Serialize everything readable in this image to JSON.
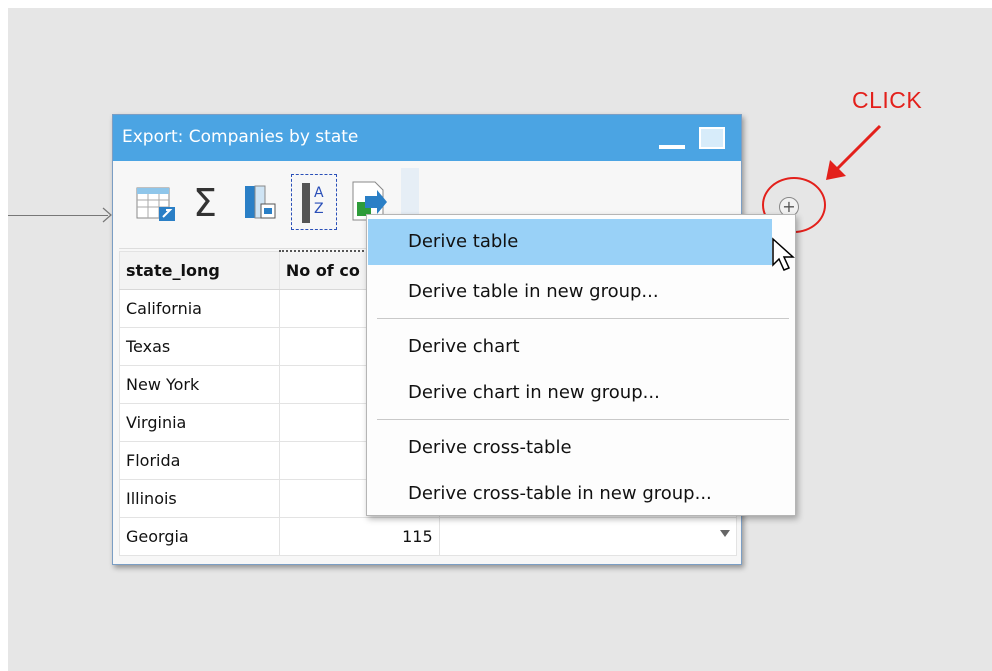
{
  "callout": {
    "text": "CLICK"
  },
  "window": {
    "title": "Export:  Companies by state",
    "toolbar_icons": [
      "table-icon",
      "sum-icon",
      "column-chart-icon",
      "sort-az-icon",
      "export-icon"
    ]
  },
  "table": {
    "headers": [
      "state_long",
      "No of co"
    ],
    "rows": [
      {
        "state": "California",
        "count": ""
      },
      {
        "state": "Texas",
        "count": ""
      },
      {
        "state": "New York",
        "count": ""
      },
      {
        "state": "Virginia",
        "count": ""
      },
      {
        "state": "Florida",
        "count": ""
      },
      {
        "state": "Illinois",
        "count": ""
      },
      {
        "state": "Georgia",
        "count": "115"
      }
    ]
  },
  "context_menu": {
    "items": [
      {
        "label": "Derive table",
        "active": true
      },
      {
        "label": "Derive table in new group..."
      },
      {
        "label": "Derive chart"
      },
      {
        "label": "Derive chart in new group..."
      },
      {
        "label": "Derive cross-table"
      },
      {
        "label": "Derive cross-table in new group..."
      }
    ]
  },
  "colors": {
    "titlebar": "#4ba4e3",
    "menu_highlight": "#99d1f7",
    "annotation": "#e3201b"
  }
}
